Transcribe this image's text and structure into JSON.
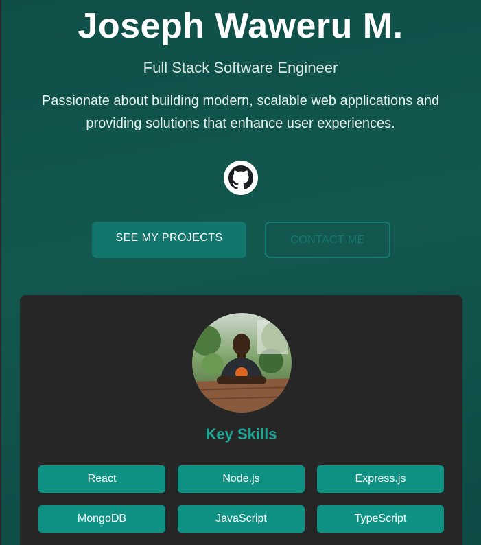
{
  "hero": {
    "name": "Joseph Waweru M.",
    "role": "Full Stack Software Engineer",
    "tagline": "Passionate about building modern, scalable web applications and providing solutions that enhance user experiences."
  },
  "social": {
    "github_icon": "github-icon"
  },
  "actions": {
    "projects_label": "SEE MY PROJECTS",
    "contact_label": "CONTACT ME"
  },
  "profile": {
    "photo_icon": "profile-photo"
  },
  "skills": {
    "heading": "Key Skills",
    "items": [
      "React",
      "Node.js",
      "Express.js",
      "MongoDB",
      "JavaScript",
      "TypeScript"
    ]
  },
  "colors": {
    "accent": "#0f9284",
    "heading_accent": "#1ea696",
    "card_bg": "#262626",
    "hero_bg": "#13584f"
  }
}
